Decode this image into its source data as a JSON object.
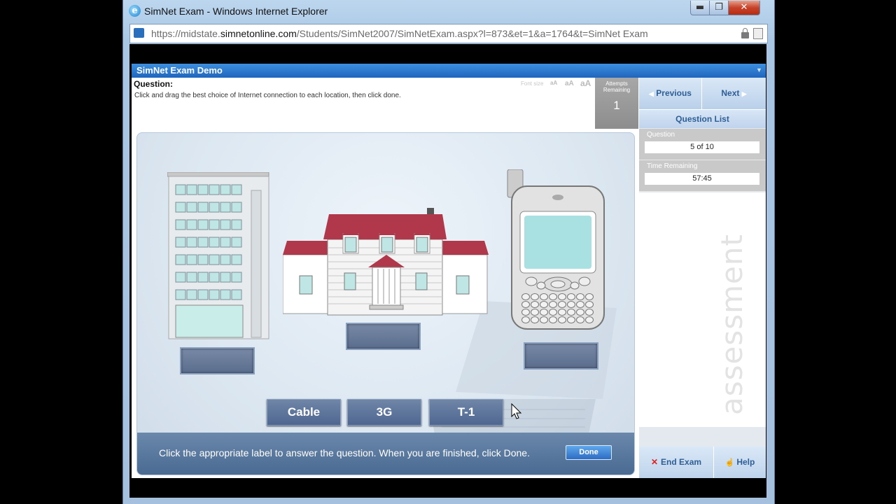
{
  "browser": {
    "title": "SimNet Exam - Windows Internet Explorer",
    "url_prefix": "https://midstate.",
    "url_domain": "simnetonline.com",
    "url_path": "/Students/SimNet2007/SimNetExam.aspx?l=873&et=1&a=1764&t=SimNet Exam",
    "minimize": "▬",
    "maximize": "❐",
    "close": "✕"
  },
  "app": {
    "title": "SimNet Exam Demo",
    "question_label": "Question:",
    "question_text": "Click and drag the best choice of Internet connection to each location, then click done.",
    "font_size_label": "Font size",
    "font_sizes": [
      "aA",
      "aA",
      "aA"
    ],
    "attempts_label": "Attempts Remaining",
    "attempts_value": "1"
  },
  "sidebar": {
    "previous": "Previous",
    "next": "Next",
    "question_list": "Question List",
    "question_label": "Question",
    "question_value": "5 of 10",
    "time_label": "Time Remaining",
    "time_value": "57:45",
    "watermark": "assessment",
    "end_exam": "End Exam",
    "help": "Help"
  },
  "simulation": {
    "labels": [
      "Cable",
      "3G",
      "T-1"
    ],
    "instruction": "Click the appropriate label to answer the question. When you are finished, click Done.",
    "done": "Done"
  },
  "icons": [
    "ie-icon",
    "site-icon",
    "lock-icon",
    "compat-icon",
    "office-building-icon",
    "house-icon",
    "smartphone-icon",
    "laptop-icon",
    "cursor-icon",
    "close-x-icon",
    "help-icon"
  ]
}
